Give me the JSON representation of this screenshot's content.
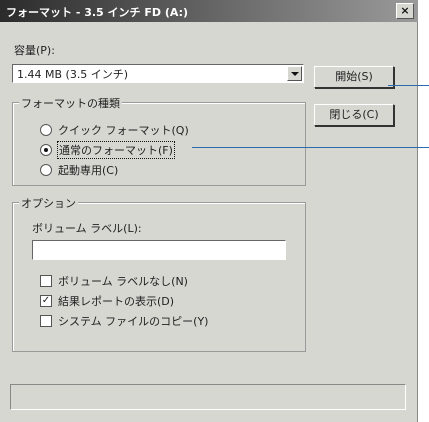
{
  "dialog": {
    "title": "フォーマット - 3.5 インチ FD (A:)",
    "close_symbol": "×"
  },
  "capacity": {
    "label": "容量(P):",
    "value": "1.44 MB (3.5 インチ)"
  },
  "format_type": {
    "title": "フォーマットの種類",
    "options": [
      {
        "label": "クイック フォーマット(Q)",
        "selected": false
      },
      {
        "label": "通常のフォーマット(F)",
        "selected": true
      },
      {
        "label": "起動専用(C)",
        "selected": false
      }
    ]
  },
  "options": {
    "title": "オプション",
    "volume_label": "ボリューム ラベル(L):",
    "volume_value": "",
    "checkboxes": [
      {
        "label": "ボリューム ラベルなし(N)",
        "checked": false
      },
      {
        "label": "結果レポートの表示(D)",
        "checked": true
      },
      {
        "label": "システム ファイルのコピー(Y)",
        "checked": false
      }
    ]
  },
  "buttons": {
    "start": "開始(S)",
    "close": "閉じる(C)"
  },
  "colors": {
    "callout": "#2b6cb0",
    "dialog_bg": "#d7d7d2"
  }
}
